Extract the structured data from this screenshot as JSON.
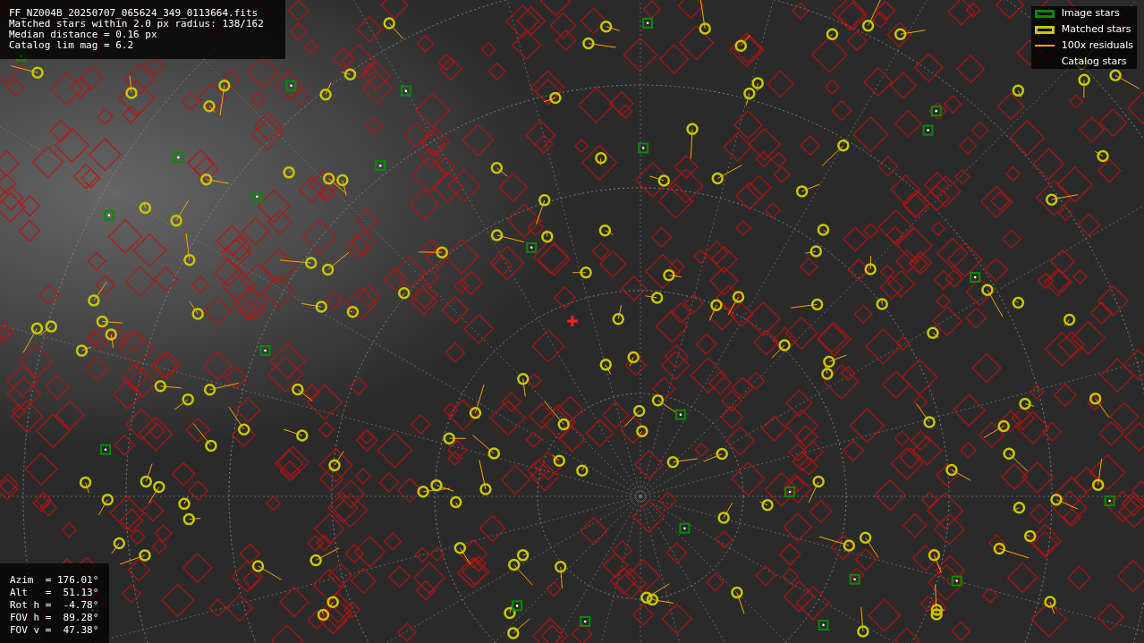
{
  "info_panel": {
    "lines": [
      "FF_NZ004B_20250707_065624_349_0113664.fits",
      "Matched stars within 2.0 px radius: 138/162",
      "Median distance = 0.16 px",
      "Catalog lim mag = 6.2"
    ]
  },
  "legend": [
    {
      "kind": "box",
      "color": "#0a8a0a",
      "label": "Image stars"
    },
    {
      "kind": "box",
      "color": "#c8c800",
      "label": "Matched stars"
    },
    {
      "kind": "line",
      "color": "#ffa500",
      "label": "100x residuals"
    },
    {
      "kind": "none",
      "label": "Catalog stars"
    }
  ],
  "pointing_panel": {
    "lines": [
      "Azim  = 176.01°",
      "Alt   =  51.13°",
      "Rot h =  -4.78°",
      "FOV h =  89.28°",
      "FOV v =  47.38°"
    ]
  }
}
